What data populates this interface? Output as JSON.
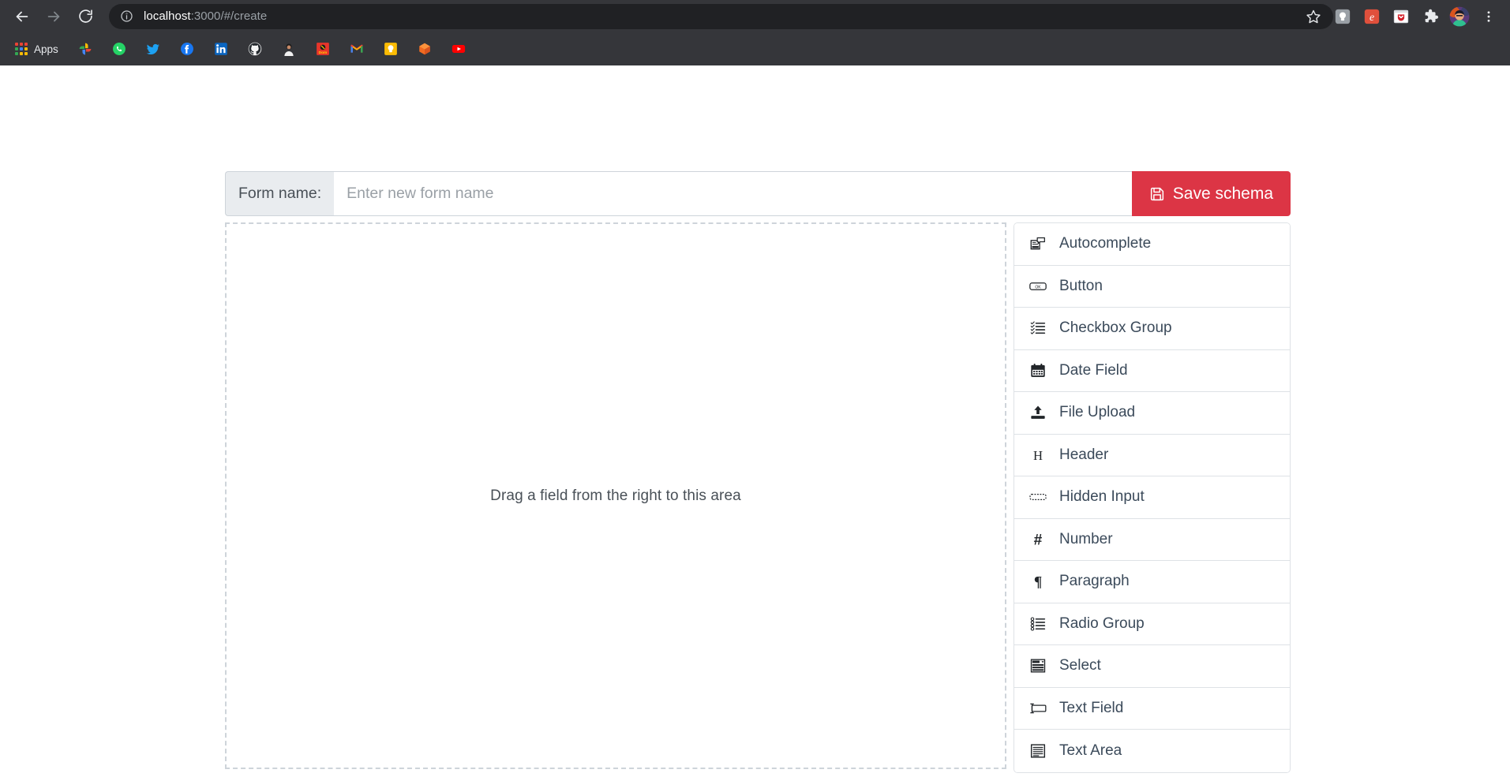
{
  "browser": {
    "nav": {
      "back": "back-arrow",
      "forward": "forward-arrow",
      "reload": "reload"
    },
    "omnibox": {
      "info_icon": "info-circle-icon",
      "url_host": "localhost",
      "url_rest": ":3000/#/create",
      "full_url": "localhost:3000/#/create"
    },
    "toolbar_icons": [
      {
        "name": "bookmark-star-icon"
      },
      {
        "name": "keep-extension-icon"
      },
      {
        "name": "evernote-extension-icon"
      },
      {
        "name": "pocket-extension-icon"
      },
      {
        "name": "extensions-puzzle-icon"
      },
      {
        "name": "profile-avatar"
      },
      {
        "name": "chrome-menu-icon"
      }
    ],
    "bookmarks": [
      {
        "label": "Apps",
        "icon": "apps-grid-icon"
      },
      {
        "label": "",
        "icon": "google-photos-icon"
      },
      {
        "label": "",
        "icon": "whatsapp-icon"
      },
      {
        "label": "",
        "icon": "twitter-icon"
      },
      {
        "label": "",
        "icon": "facebook-icon"
      },
      {
        "label": "",
        "icon": "linkedin-icon"
      },
      {
        "label": "",
        "icon": "github-icon"
      },
      {
        "label": "",
        "icon": "person-avatar-icon"
      },
      {
        "label": "",
        "icon": "dom-red-icon"
      },
      {
        "label": "",
        "icon": "gmail-icon"
      },
      {
        "label": "",
        "icon": "google-keep-icon"
      },
      {
        "label": "",
        "icon": "orange-box-icon"
      },
      {
        "label": "",
        "icon": "youtube-icon"
      }
    ]
  },
  "form_builder": {
    "name_label": "Form name:",
    "name_value": "",
    "name_placeholder": "Enter new form name",
    "save_button": {
      "label": "Save schema",
      "icon": "floppy-disk-save-icon",
      "color": "#dc3545"
    },
    "drop_area": {
      "hint": "Drag a field from the right to this area"
    },
    "palette": {
      "items": [
        {
          "label": "Autocomplete",
          "icon": "autocomplete-icon"
        },
        {
          "label": "Button",
          "icon": "button-icon"
        },
        {
          "label": "Checkbox Group",
          "icon": "checkbox-list-icon"
        },
        {
          "label": "Date Field",
          "icon": "calendar-icon"
        },
        {
          "label": "File Upload",
          "icon": "upload-icon"
        },
        {
          "label": "Header",
          "icon": "heading-h-icon"
        },
        {
          "label": "Hidden Input",
          "icon": "hidden-input-icon"
        },
        {
          "label": "Number",
          "icon": "hash-number-icon"
        },
        {
          "label": "Paragraph",
          "icon": "pilcrow-paragraph-icon"
        },
        {
          "label": "Radio Group",
          "icon": "radio-list-icon"
        },
        {
          "label": "Select",
          "icon": "select-dropdown-icon"
        },
        {
          "label": "Text Field",
          "icon": "text-field-icon"
        },
        {
          "label": "Text Area",
          "icon": "text-area-icon"
        }
      ]
    }
  },
  "theme": {
    "chrome_bg": "#35363a",
    "omnibox_bg": "#202124",
    "accent_red": "#dc3545",
    "border_gray": "#dee2e6",
    "label_bg": "#e9ecef",
    "text_dark": "#3b4a5a"
  }
}
